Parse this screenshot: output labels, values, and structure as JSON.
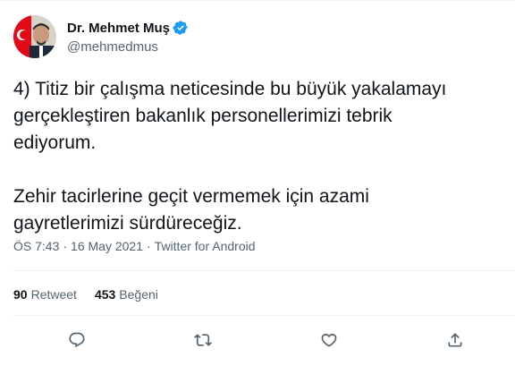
{
  "author": {
    "display_name": "Dr. Mehmet Muş",
    "handle": "@mehmedmus",
    "verified": true,
    "verified_color": "#1d9bf0",
    "avatar_flag_color": "#e30a17"
  },
  "tweet": {
    "lines_para1": [
      "4) Titiz bir çalışma neticesinde bu büyük yakalamayı",
      "gerçekleştiren bakanlık personellerimizi tebrik",
      "ediyorum."
    ],
    "lines_para2": [
      "Zehir tacirlerine geçit vermemek için azami",
      "gayretlerimizi sürdüreceğiz."
    ]
  },
  "meta": {
    "time": "ÖS 7:43",
    "separator": "·",
    "date": "16 May 2021",
    "source": "Twitter for Android"
  },
  "stats": {
    "retweet_count": "90",
    "retweet_label": "Retweet",
    "like_count": "453",
    "like_label": "Beğeni"
  },
  "actions": {
    "icons": [
      "reply-icon",
      "retweet-icon",
      "like-icon",
      "share-icon"
    ]
  }
}
